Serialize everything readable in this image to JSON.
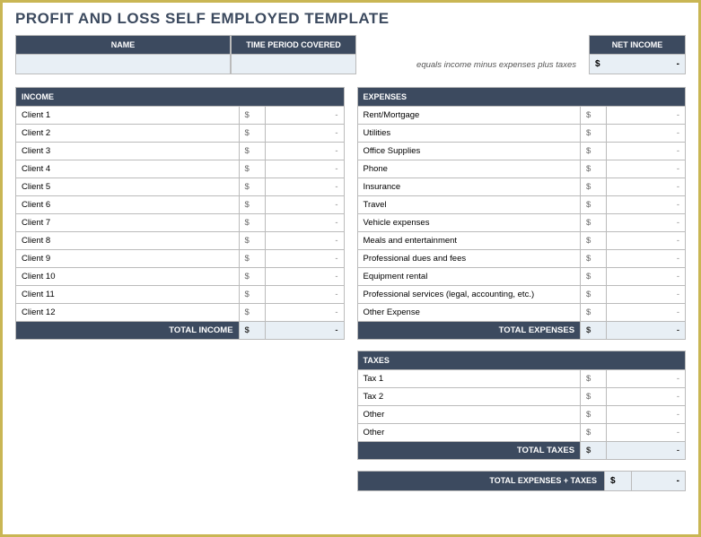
{
  "title": "PROFIT AND LOSS SELF EMPLOYED TEMPLATE",
  "headers": {
    "name": "NAME",
    "time_period": "TIME PERIOD COVERED",
    "net_income": "NET INCOME"
  },
  "net_income_note": "equals income minus expenses plus taxes",
  "currency": "$",
  "dash": "-",
  "income": {
    "header": "INCOME",
    "rows": [
      {
        "label": "Client 1",
        "value": "-"
      },
      {
        "label": "Client 2",
        "value": "-"
      },
      {
        "label": "Client 3",
        "value": "-"
      },
      {
        "label": "Client 4",
        "value": "-"
      },
      {
        "label": "Client 5",
        "value": "-"
      },
      {
        "label": "Client 6",
        "value": "-"
      },
      {
        "label": "Client 7",
        "value": "-"
      },
      {
        "label": "Client 8",
        "value": "-"
      },
      {
        "label": "Client 9",
        "value": "-"
      },
      {
        "label": "Client 10",
        "value": "-"
      },
      {
        "label": "Client 11",
        "value": "-"
      },
      {
        "label": "Client 12",
        "value": "-"
      }
    ],
    "total_label": "TOTAL INCOME",
    "total_value": "-"
  },
  "expenses": {
    "header": "EXPENSES",
    "rows": [
      {
        "label": "Rent/Mortgage",
        "value": "-"
      },
      {
        "label": "Utilities",
        "value": "-"
      },
      {
        "label": "Office Supplies",
        "value": "-"
      },
      {
        "label": "Phone",
        "value": "-"
      },
      {
        "label": "Insurance",
        "value": "-"
      },
      {
        "label": "Travel",
        "value": "-"
      },
      {
        "label": "Vehicle expenses",
        "value": "-"
      },
      {
        "label": "Meals and entertainment",
        "value": "-"
      },
      {
        "label": "Professional dues and fees",
        "value": "-"
      },
      {
        "label": "Equipment rental",
        "value": "-"
      },
      {
        "label": "Professional services (legal, accounting, etc.)",
        "value": "-"
      },
      {
        "label": "Other Expense",
        "value": "-"
      }
    ],
    "total_label": "TOTAL EXPENSES",
    "total_value": "-"
  },
  "taxes": {
    "header": "TAXES",
    "rows": [
      {
        "label": "Tax 1",
        "value": "-"
      },
      {
        "label": "Tax 2",
        "value": "-"
      },
      {
        "label": "Other",
        "value": "-"
      },
      {
        "label": "Other",
        "value": "-"
      }
    ],
    "total_label": "TOTAL TAXES",
    "total_value": "-"
  },
  "grand_total": {
    "label": "TOTAL EXPENSES + TAXES",
    "value": "-"
  }
}
